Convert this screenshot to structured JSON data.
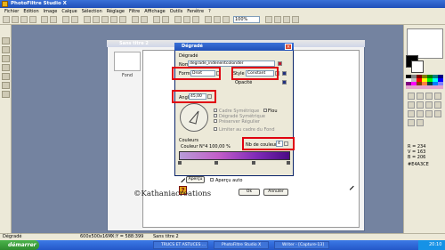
{
  "app": {
    "title": "PhotoFiltre Studio X"
  },
  "menu": [
    "Fichier",
    "Edition",
    "Image",
    "Calque",
    "Sélection",
    "Réglage",
    "Filtre",
    "Affichage",
    "Outils",
    "Fenêtre",
    "?"
  ],
  "toolbar": {
    "zoom": "100%"
  },
  "document": {
    "title": "Sans titre 2",
    "thumb_label": "Fond"
  },
  "dialog": {
    "title": "Dégradé",
    "group": "Dégradé",
    "nom_label": "Nom",
    "nom_value": "degrade_indenentcolonder",
    "forme_label": "Forme",
    "forme_value": "Droit",
    "style_label": "Style",
    "style_value": "Constant",
    "opacite_label": "Opacité",
    "angle_label": "Angle",
    "angle_value": "45,00",
    "flou_label": "Flou",
    "opt1": "Cadre Symétrique",
    "opt2": "Dégradé Symétrique",
    "opt3": "Préserver Régulier",
    "opt4": "Limiter au cadre du Fond",
    "couleurs_label": "Couleurs",
    "couleur_info": "Couleur N°4  100,00 %",
    "nb_couleurs_label": "Nb de couleurs",
    "nb_couleurs_value": "4",
    "apercu_button": "Aperçu",
    "apercu_auto": "Aperçu auto",
    "ok_button": "Ok",
    "annuler_button": "Annuler"
  },
  "rightpanel": {
    "r": "R = 234",
    "g": "V = 163",
    "b": "B = 206",
    "hex": "#E4A3CE"
  },
  "status": {
    "left": "Dégradé",
    "size": "600x500x16M",
    "coords": "X:Y = 588:399",
    "doc": "Sans titre 2"
  },
  "taskbar": {
    "start": "démarrer",
    "tasks": [
      "TRUCS ET ASTUCES ...",
      "PhotoFiltre Studio X",
      "Writer - [Capture-13]"
    ],
    "time": "20:10"
  },
  "watermark": "©Kathaniacreations"
}
